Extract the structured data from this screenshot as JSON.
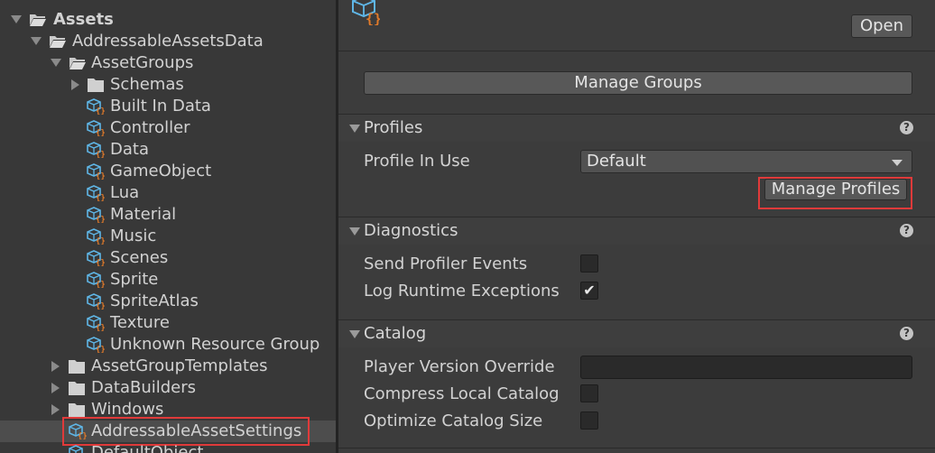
{
  "project_tree": {
    "root": {
      "label": "Assets"
    },
    "addressable_data": {
      "label": "AddressableAssetsData"
    },
    "asset_groups": {
      "label": "AssetGroups",
      "schemas": "Schemas",
      "items": [
        "Built In Data",
        "Controller",
        "Data",
        "GameObject",
        "Lua",
        "Material",
        "Music",
        "Scenes",
        "Sprite",
        "SpriteAtlas",
        "Texture",
        "Unknown Resource Group"
      ]
    },
    "folders": [
      "AssetGroupTemplates",
      "DataBuilders",
      "Windows"
    ],
    "selected_asset": "AddressableAssetSettings",
    "next_asset": "DefaultObject"
  },
  "inspector": {
    "open_button": "Open",
    "manage_groups_button": "Manage Groups",
    "profiles": {
      "title": "Profiles",
      "help": "?",
      "profile_in_use_label": "Profile In Use",
      "profile_in_use_value": "Default",
      "manage_profiles_button": "Manage Profiles"
    },
    "diagnostics": {
      "title": "Diagnostics",
      "help": "?",
      "send_profiler_events_label": "Send Profiler Events",
      "send_profiler_events_checked": false,
      "log_runtime_exceptions_label": "Log Runtime Exceptions",
      "log_runtime_exceptions_checked": true
    },
    "catalog": {
      "title": "Catalog",
      "help": "?",
      "player_version_override_label": "Player Version Override",
      "player_version_override_value": "",
      "compress_local_catalog_label": "Compress Local Catalog",
      "compress_local_catalog_checked": false,
      "optimize_catalog_size_label": "Optimize Catalog Size",
      "optimize_catalog_size_checked": false
    }
  },
  "colors": {
    "highlight": "#e03a3a",
    "asset_icon_blue": "#5fb6e6",
    "asset_icon_orange": "#e07a2a",
    "folder_icon": "#c9c9c9"
  },
  "icons": {
    "folder_open": "folder-open-icon",
    "folder": "folder-icon",
    "asset_group": "addressable-asset-group-icon",
    "settings_asset": "addressable-settings-icon"
  }
}
